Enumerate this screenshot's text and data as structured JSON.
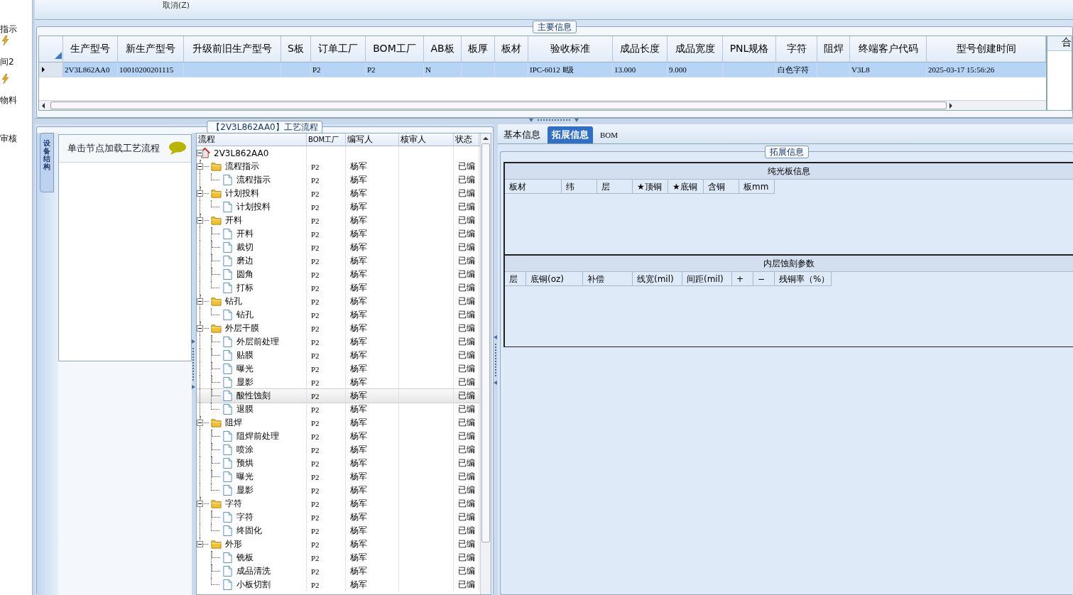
{
  "side_menu": [
    {
      "label": "指示",
      "icon": false
    },
    {
      "label": "间2",
      "icon": true
    },
    {
      "label": "物料",
      "icon": true
    },
    {
      "label": "审核",
      "icon": false
    }
  ],
  "toolbar": {
    "cancel": "取消(Z)"
  },
  "main_info": {
    "title": "主要信息",
    "columns": [
      "生产型号",
      "新生产型号",
      "升级前旧生产型号",
      "S板",
      "订单工厂",
      "BOM工厂",
      "AB板",
      "板厚",
      "板材",
      "验收标准",
      "成品长度",
      "成品宽度",
      "PNL规格",
      "字符",
      "阻焊",
      "终端客户代码",
      "型号创建时间"
    ],
    "rows": [
      {
        "selected": true,
        "cells": [
          "2V3L862AA0",
          "10010200201115",
          "",
          "",
          "P2",
          "P2",
          "N",
          "",
          "",
          "IPC-6012 Ⅱ级",
          "13.000",
          "9.000",
          "",
          "白色字符",
          "",
          "V3L8",
          "2025-03-17 15:56:26"
        ]
      }
    ],
    "side_column": "合"
  },
  "process": {
    "title": "【2V3L862AA0】工艺流程",
    "side_tab": "设备结构",
    "hint": "单击节点加载工艺流程",
    "columns": [
      "流程",
      "BOM工厂",
      "编写人",
      "核审人",
      "状态"
    ],
    "tree": {
      "kind": "root",
      "label": "2V3L862AA0",
      "expanded": true,
      "selected": false,
      "children": [
        {
          "kind": "folder",
          "label": "流程指示",
          "factory": "P2",
          "writer": "杨军",
          "status": "已编",
          "expanded": true,
          "selected": false,
          "children": [
            {
              "kind": "step",
              "label": "流程指示",
              "factory": "P2",
              "writer": "杨军",
              "status": "已编",
              "selected": false
            }
          ]
        },
        {
          "kind": "folder",
          "label": "计划投料",
          "factory": "P2",
          "writer": "杨军",
          "status": "已编",
          "expanded": true,
          "selected": false,
          "children": [
            {
              "kind": "step",
              "label": "计划投料",
              "factory": "P2",
              "writer": "杨军",
              "status": "已编",
              "selected": false
            }
          ]
        },
        {
          "kind": "folder",
          "label": "开料",
          "factory": "P2",
          "writer": "杨军",
          "status": "已编",
          "expanded": true,
          "selected": false,
          "children": [
            {
              "kind": "step",
              "label": "开料",
              "factory": "P2",
              "writer": "杨军",
              "status": "已编",
              "selected": false
            },
            {
              "kind": "step",
              "label": "裁切",
              "factory": "P2",
              "writer": "杨军",
              "status": "已编",
              "selected": false
            },
            {
              "kind": "step",
              "label": "磨边",
              "factory": "P2",
              "writer": "杨军",
              "status": "已编",
              "selected": false
            },
            {
              "kind": "step",
              "label": "圆角",
              "factory": "P2",
              "writer": "杨军",
              "status": "已编",
              "selected": false
            },
            {
              "kind": "step",
              "label": "打标",
              "factory": "P2",
              "writer": "杨军",
              "status": "已编",
              "selected": false
            }
          ]
        },
        {
          "kind": "folder",
          "label": "钻孔",
          "factory": "P2",
          "writer": "杨军",
          "status": "已编",
          "expanded": true,
          "selected": false,
          "children": [
            {
              "kind": "step",
              "label": "钻孔",
              "factory": "P2",
              "writer": "杨军",
              "status": "已编",
              "selected": false
            }
          ]
        },
        {
          "kind": "folder",
          "label": "外层干膜",
          "factory": "P2",
          "writer": "杨军",
          "status": "已编",
          "expanded": true,
          "selected": false,
          "children": [
            {
              "kind": "step",
              "label": "外层前处理",
              "factory": "P2",
              "writer": "杨军",
              "status": "已编",
              "selected": false
            },
            {
              "kind": "step",
              "label": "贴膜",
              "factory": "P2",
              "writer": "杨军",
              "status": "已编",
              "selected": false
            },
            {
              "kind": "step",
              "label": "曝光",
              "factory": "P2",
              "writer": "杨军",
              "status": "已编",
              "selected": false
            },
            {
              "kind": "step",
              "label": "显影",
              "factory": "P2",
              "writer": "杨军",
              "status": "已编",
              "selected": false
            },
            {
              "kind": "step",
              "label": "酸性蚀刻",
              "factory": "P2",
              "writer": "杨军",
              "status": "已编",
              "selected": true
            },
            {
              "kind": "step",
              "label": "退膜",
              "factory": "P2",
              "writer": "杨军",
              "status": "已编",
              "selected": false
            }
          ]
        },
        {
          "kind": "folder",
          "label": "阻焊",
          "factory": "P2",
          "writer": "杨军",
          "status": "已编",
          "expanded": true,
          "selected": false,
          "children": [
            {
              "kind": "step",
              "label": "阻焊前处理",
              "factory": "P2",
              "writer": "杨军",
              "status": "已编",
              "selected": false
            },
            {
              "kind": "step",
              "label": "喷涂",
              "factory": "P2",
              "writer": "杨军",
              "status": "已编",
              "selected": false
            },
            {
              "kind": "step",
              "label": "预烘",
              "factory": "P2",
              "writer": "杨军",
              "status": "已编",
              "selected": false
            },
            {
              "kind": "step",
              "label": "曝光",
              "factory": "P2",
              "writer": "杨军",
              "status": "已编",
              "selected": false
            },
            {
              "kind": "step",
              "label": "显影",
              "factory": "P2",
              "writer": "杨军",
              "status": "已编",
              "selected": false
            }
          ]
        },
        {
          "kind": "folder",
          "label": "字符",
          "factory": "P2",
          "writer": "杨军",
          "status": "已编",
          "expanded": true,
          "selected": false,
          "children": [
            {
              "kind": "step",
              "label": "字符",
              "factory": "P2",
              "writer": "杨军",
              "status": "已编",
              "selected": false
            },
            {
              "kind": "step",
              "label": "终固化",
              "factory": "P2",
              "writer": "杨军",
              "status": "已编",
              "selected": false
            }
          ]
        },
        {
          "kind": "folder",
          "label": "外形",
          "factory": "P2",
          "writer": "杨军",
          "status": "已编",
          "expanded": true,
          "selected": false,
          "children": [
            {
              "kind": "step",
              "label": "铣板",
              "factory": "P2",
              "writer": "杨军",
              "status": "已编",
              "selected": false
            },
            {
              "kind": "step",
              "label": "成品清洗",
              "factory": "P2",
              "writer": "杨军",
              "status": "已编",
              "selected": false
            },
            {
              "kind": "step",
              "label": "小板切割",
              "factory": "P2",
              "writer": "杨军",
              "status": "已编",
              "selected": false
            }
          ]
        }
      ]
    }
  },
  "detail": {
    "tabs": [
      {
        "label": "基本信息",
        "selected": false
      },
      {
        "label": "拓展信息",
        "selected": true
      },
      {
        "label": "BOM",
        "selected": false
      }
    ],
    "group_title": "拓展信息",
    "sections": [
      {
        "title": "纯光板信息",
        "columns": [
          "板材",
          "纬",
          "层",
          "★顶铜",
          "★底铜",
          "含铜",
          "板mm"
        ]
      },
      {
        "title": "内层蚀刻参数",
        "columns": [
          "层",
          "底铜(oz)",
          "补偿",
          "线宽(mil)",
          "间距(mil)",
          "+",
          "−",
          "残铜率（%）"
        ]
      }
    ]
  }
}
